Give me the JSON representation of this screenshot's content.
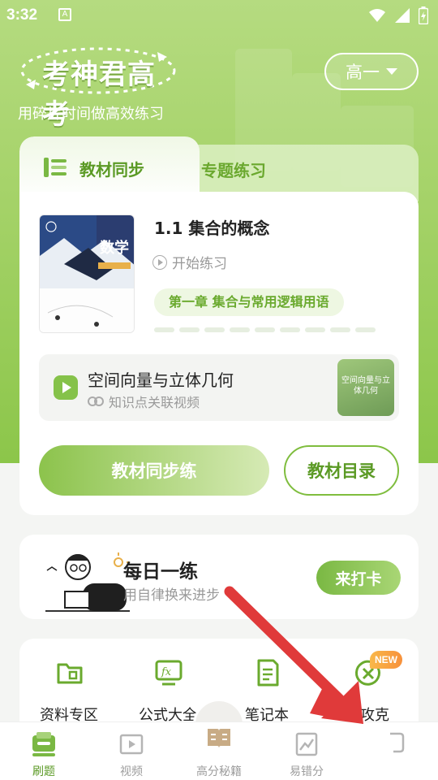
{
  "status_bar": {
    "time": "3:32",
    "notif_glyph": "A"
  },
  "header": {
    "logo_text": "考神君高考",
    "tagline": "用碎片时间做高效练习",
    "grade_selector": "高一"
  },
  "main_card": {
    "tabs": [
      {
        "label": "教材同步",
        "active": true
      },
      {
        "label": "专题练习",
        "active": false
      }
    ],
    "lesson": {
      "title": "1.1 集合的概念",
      "start_label": "开始练习",
      "chapter": "第一章 集合与常用逻辑用语",
      "book_title": "数学"
    },
    "video": {
      "title": "空间向量与立体几何",
      "subtitle": "知识点关联视频",
      "thumb_text": "空间向量与立体几何"
    },
    "primary_button": "教材同步练",
    "secondary_button": "教材目录"
  },
  "daily": {
    "title": "每日一练",
    "subtitle": "用自律换来进步",
    "button": "来打卡"
  },
  "tools": {
    "items": [
      {
        "label": "资料专区",
        "icon": "folder-icon"
      },
      {
        "label": "公式大全",
        "icon": "formula-icon"
      },
      {
        "label": "笔记本",
        "icon": "notebook-icon"
      },
      {
        "label": "错攻克",
        "icon": "mistake-icon"
      }
    ],
    "new_badge": "NEW"
  },
  "bottom_nav": {
    "items": [
      {
        "label": "刷题",
        "icon": "practice-icon",
        "active": true
      },
      {
        "label": "视频",
        "icon": "video-icon",
        "active": false
      },
      {
        "label": "高分秘籍",
        "icon": "book-icon",
        "active": false
      },
      {
        "label": "易错分",
        "icon": "chart-icon",
        "active": false
      },
      {
        "label": "",
        "icon": "profile-icon",
        "active": false
      }
    ]
  },
  "colors": {
    "accent": "#7ab843",
    "accent_dark": "#5b9a25",
    "arrow": "#e03a3a",
    "badge": "#f7913b"
  }
}
